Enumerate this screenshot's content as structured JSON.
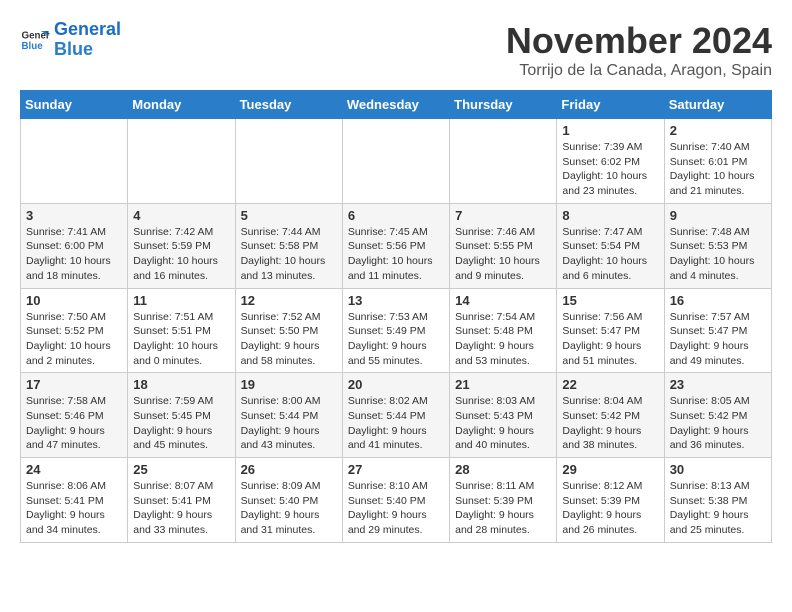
{
  "header": {
    "logo_line1": "General",
    "logo_line2": "Blue",
    "month_year": "November 2024",
    "location": "Torrijo de la Canada, Aragon, Spain"
  },
  "weekdays": [
    "Sunday",
    "Monday",
    "Tuesday",
    "Wednesday",
    "Thursday",
    "Friday",
    "Saturday"
  ],
  "weeks": [
    [
      {
        "day": "",
        "info": ""
      },
      {
        "day": "",
        "info": ""
      },
      {
        "day": "",
        "info": ""
      },
      {
        "day": "",
        "info": ""
      },
      {
        "day": "",
        "info": ""
      },
      {
        "day": "1",
        "info": "Sunrise: 7:39 AM\nSunset: 6:02 PM\nDaylight: 10 hours\nand 23 minutes."
      },
      {
        "day": "2",
        "info": "Sunrise: 7:40 AM\nSunset: 6:01 PM\nDaylight: 10 hours\nand 21 minutes."
      }
    ],
    [
      {
        "day": "3",
        "info": "Sunrise: 7:41 AM\nSunset: 6:00 PM\nDaylight: 10 hours\nand 18 minutes."
      },
      {
        "day": "4",
        "info": "Sunrise: 7:42 AM\nSunset: 5:59 PM\nDaylight: 10 hours\nand 16 minutes."
      },
      {
        "day": "5",
        "info": "Sunrise: 7:44 AM\nSunset: 5:58 PM\nDaylight: 10 hours\nand 13 minutes."
      },
      {
        "day": "6",
        "info": "Sunrise: 7:45 AM\nSunset: 5:56 PM\nDaylight: 10 hours\nand 11 minutes."
      },
      {
        "day": "7",
        "info": "Sunrise: 7:46 AM\nSunset: 5:55 PM\nDaylight: 10 hours\nand 9 minutes."
      },
      {
        "day": "8",
        "info": "Sunrise: 7:47 AM\nSunset: 5:54 PM\nDaylight: 10 hours\nand 6 minutes."
      },
      {
        "day": "9",
        "info": "Sunrise: 7:48 AM\nSunset: 5:53 PM\nDaylight: 10 hours\nand 4 minutes."
      }
    ],
    [
      {
        "day": "10",
        "info": "Sunrise: 7:50 AM\nSunset: 5:52 PM\nDaylight: 10 hours\nand 2 minutes."
      },
      {
        "day": "11",
        "info": "Sunrise: 7:51 AM\nSunset: 5:51 PM\nDaylight: 10 hours\nand 0 minutes."
      },
      {
        "day": "12",
        "info": "Sunrise: 7:52 AM\nSunset: 5:50 PM\nDaylight: 9 hours\nand 58 minutes."
      },
      {
        "day": "13",
        "info": "Sunrise: 7:53 AM\nSunset: 5:49 PM\nDaylight: 9 hours\nand 55 minutes."
      },
      {
        "day": "14",
        "info": "Sunrise: 7:54 AM\nSunset: 5:48 PM\nDaylight: 9 hours\nand 53 minutes."
      },
      {
        "day": "15",
        "info": "Sunrise: 7:56 AM\nSunset: 5:47 PM\nDaylight: 9 hours\nand 51 minutes."
      },
      {
        "day": "16",
        "info": "Sunrise: 7:57 AM\nSunset: 5:47 PM\nDaylight: 9 hours\nand 49 minutes."
      }
    ],
    [
      {
        "day": "17",
        "info": "Sunrise: 7:58 AM\nSunset: 5:46 PM\nDaylight: 9 hours\nand 47 minutes."
      },
      {
        "day": "18",
        "info": "Sunrise: 7:59 AM\nSunset: 5:45 PM\nDaylight: 9 hours\nand 45 minutes."
      },
      {
        "day": "19",
        "info": "Sunrise: 8:00 AM\nSunset: 5:44 PM\nDaylight: 9 hours\nand 43 minutes."
      },
      {
        "day": "20",
        "info": "Sunrise: 8:02 AM\nSunset: 5:44 PM\nDaylight: 9 hours\nand 41 minutes."
      },
      {
        "day": "21",
        "info": "Sunrise: 8:03 AM\nSunset: 5:43 PM\nDaylight: 9 hours\nand 40 minutes."
      },
      {
        "day": "22",
        "info": "Sunrise: 8:04 AM\nSunset: 5:42 PM\nDaylight: 9 hours\nand 38 minutes."
      },
      {
        "day": "23",
        "info": "Sunrise: 8:05 AM\nSunset: 5:42 PM\nDaylight: 9 hours\nand 36 minutes."
      }
    ],
    [
      {
        "day": "24",
        "info": "Sunrise: 8:06 AM\nSunset: 5:41 PM\nDaylight: 9 hours\nand 34 minutes."
      },
      {
        "day": "25",
        "info": "Sunrise: 8:07 AM\nSunset: 5:41 PM\nDaylight: 9 hours\nand 33 minutes."
      },
      {
        "day": "26",
        "info": "Sunrise: 8:09 AM\nSunset: 5:40 PM\nDaylight: 9 hours\nand 31 minutes."
      },
      {
        "day": "27",
        "info": "Sunrise: 8:10 AM\nSunset: 5:40 PM\nDaylight: 9 hours\nand 29 minutes."
      },
      {
        "day": "28",
        "info": "Sunrise: 8:11 AM\nSunset: 5:39 PM\nDaylight: 9 hours\nand 28 minutes."
      },
      {
        "day": "29",
        "info": "Sunrise: 8:12 AM\nSunset: 5:39 PM\nDaylight: 9 hours\nand 26 minutes."
      },
      {
        "day": "30",
        "info": "Sunrise: 8:13 AM\nSunset: 5:38 PM\nDaylight: 9 hours\nand 25 minutes."
      }
    ]
  ]
}
